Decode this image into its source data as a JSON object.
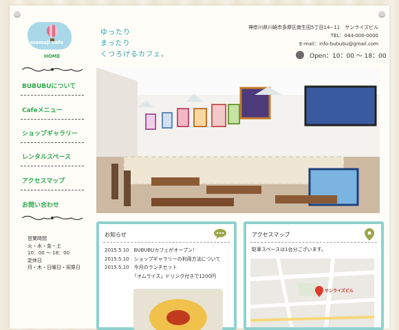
{
  "brand": {
    "logo_text": "mamaji cafe",
    "home_label": "HOME"
  },
  "tagline": [
    "ゆったり",
    "まったり",
    "くつろげるカフェ。"
  ],
  "contact": {
    "address": "神奈川県川崎市多摩区南生田5丁目14−11　サンライズビル",
    "tel": "TEL：044-000-0000",
    "email": "E-mail：info-bububu@gmail.com",
    "open_hours": "Open：10：00 〜 18：00"
  },
  "nav": [
    {
      "label": "BUBUBUについて"
    },
    {
      "label": "Cafeメニュー"
    },
    {
      "label": "ショップギャラリー"
    },
    {
      "label": "レンタルスペース"
    },
    {
      "label": "アクセスマップ"
    },
    {
      "label": "お問い合わせ"
    }
  ],
  "hours_info": {
    "lines": [
      "営業時間",
      "火・水・金・土",
      "10：00 〜 18：00",
      "定休日",
      "月・木・日曜日・祝祭日"
    ]
  },
  "news": {
    "title": "お知らせ",
    "items": [
      {
        "date": "2015.5.10",
        "text": "BUBUBUカフェがオープン！"
      },
      {
        "date": "2015.5.10",
        "text": "ショップギャラリーの利用方法について"
      },
      {
        "date": "2015.5.10",
        "text": "今月のランチセット"
      },
      {
        "date": "",
        "text": "「オムライス」ドリンク付きで1200円"
      }
    ]
  },
  "access": {
    "title": "アクセスマップ",
    "note": "駐車スペースは1台分ございます。",
    "map_label": "サンライズビル"
  },
  "colors": {
    "accent_green": "#2fa84f",
    "teal_border": "#8fd1cf",
    "tagline": "#2fa0a8"
  }
}
